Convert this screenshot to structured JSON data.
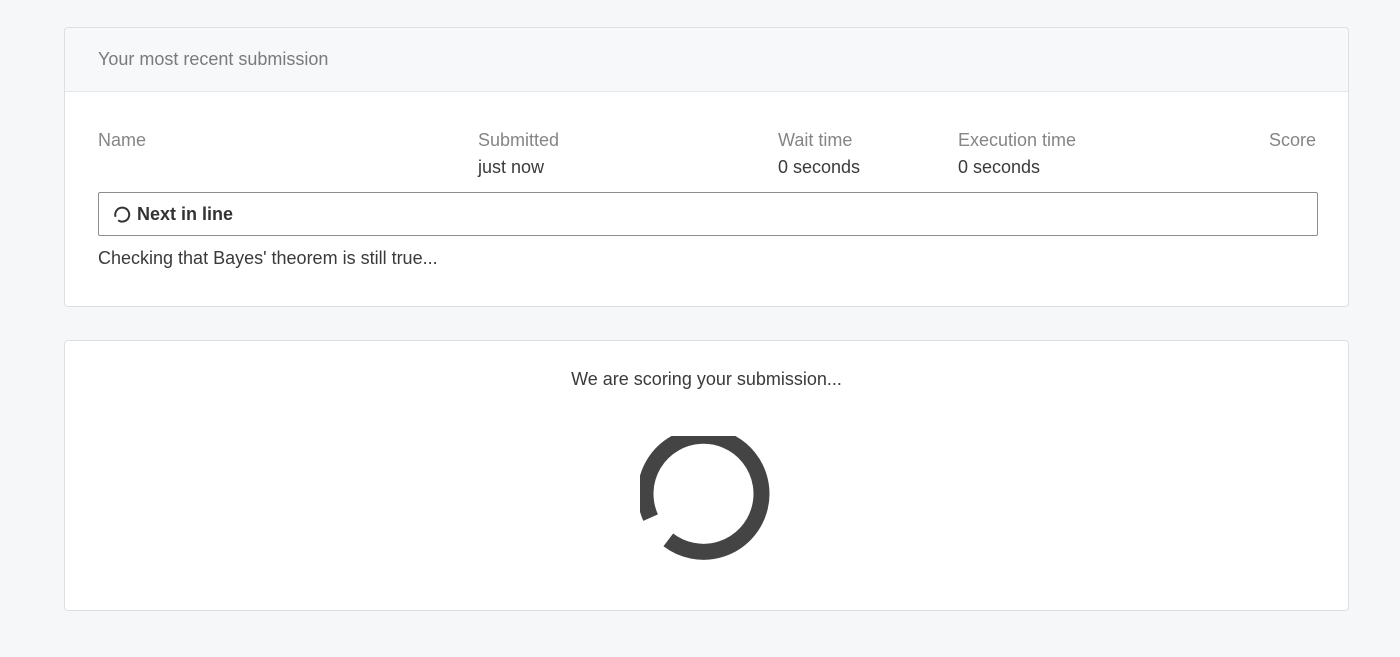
{
  "recent": {
    "header": "Your most recent submission",
    "columns": {
      "name": {
        "label": "Name",
        "value": ""
      },
      "submitted": {
        "label": "Submitted",
        "value": "just now"
      },
      "wait_time": {
        "label": "Wait time",
        "value": "0 seconds"
      },
      "execution_time": {
        "label": "Execution time",
        "value": "0 seconds"
      },
      "score": {
        "label": "Score",
        "value": ""
      }
    },
    "status": {
      "label": "Next in line",
      "icon": "loading-spinner-icon"
    },
    "message": "Checking that Bayes' theorem is still true..."
  },
  "scoring": {
    "text": "We are scoring your submission...",
    "icon": "loading-spinner-icon"
  },
  "colors": {
    "background": "#f6f7f9",
    "spinner": "#444444"
  }
}
